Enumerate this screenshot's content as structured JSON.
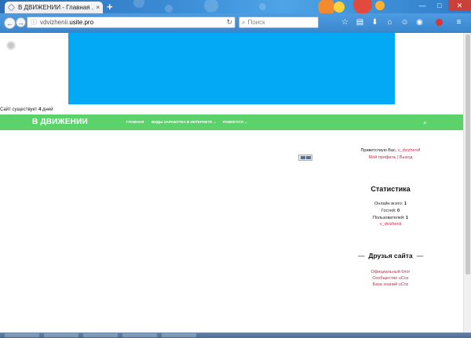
{
  "browser": {
    "tab_title": "В ДВИЖЕНИИ - Главная ...",
    "tab_close": "×",
    "new_tab": "+",
    "url_prefix": "vdvizhenii.",
    "url_host": "usite.pro",
    "search_placeholder": "Поиск",
    "window_minimize": "—",
    "window_maximize": "□",
    "window_close": "✕"
  },
  "site": {
    "age_prefix": "Сайт существует ",
    "age_value": "4",
    "age_suffix": " дней",
    "brand": "В ДВИЖЕНИИ",
    "menu": [
      "ГЛАВНАЯ",
      "ВИДЫ ЗАРАБОТКА В ИНТЕРНЕТЕ",
      "ПОМОГАТИ"
    ],
    "banner_color": "#03a9f4",
    "nav_color": "#5cd36a"
  },
  "sidebar": {
    "welcome_prefix": "Приветствую Вас, ",
    "username": "v_dvizhenii",
    "welcome_suffix": "!",
    "profile_link": "Мой профиль",
    "separator": " | ",
    "logout_link": "Выход",
    "stats_title": "Статистика",
    "online_label": "Онлайн всего: ",
    "online_value": "1",
    "guests_label": "Гостей: ",
    "guests_value": "0",
    "users_label": "Пользователей: ",
    "users_value": "1",
    "online_user": "v_dvizhenii",
    "friends_title": "Друзья сайта",
    "friends": [
      "Официальный блог",
      "Сообщество uCoz",
      "База знаний uCoz"
    ],
    "link_color": "#d2274a"
  }
}
